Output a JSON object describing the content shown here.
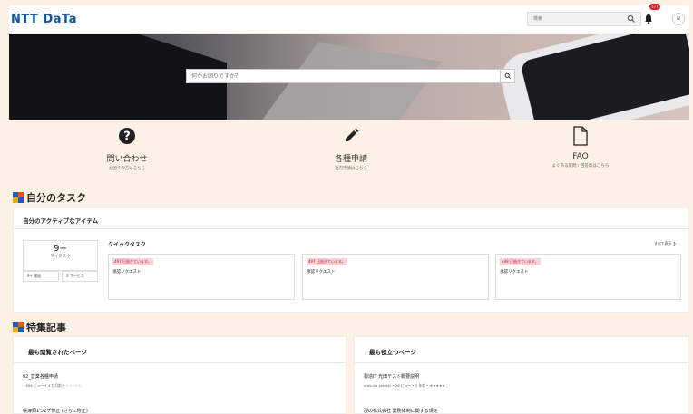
{
  "header": {
    "logo": "NTT DaTa",
    "search_placeholder": "検索",
    "notification_count": "177",
    "avatar_initial": "N"
  },
  "hero": {
    "search_placeholder": "何かお困りですか？"
  },
  "actions": [
    {
      "label": "問い合わせ",
      "sub": "お困りの方はこちら",
      "icon": "question-circle-icon"
    },
    {
      "label": "各種申請",
      "sub": "社内申請はこちら",
      "icon": "pencil-icon"
    },
    {
      "label": "FAQ",
      "sub": "よくある質問 / 回答集はこちら",
      "icon": "document-icon"
    }
  ],
  "tasks": {
    "section_title": "自分のタスク",
    "card_title": "自分のアクティブなアイテム",
    "my_task_count": "9+",
    "my_task_label": "マイタスク",
    "button_overdue": "9+ 遅延",
    "button_service": "0 サービス",
    "quick_title": "クイックタスク",
    "see_all": "すべて表示 ❯",
    "tiles": [
      {
        "tag": "497 日過ぎています。",
        "name": "承認リクエスト"
      },
      {
        "tag": "497 日過ぎています。",
        "name": "承認リクエスト"
      },
      {
        "tag": "498 日過ぎています。",
        "name": "承認リクエスト"
      }
    ]
  },
  "featured": {
    "section_title": "特集記事",
    "most_viewed": {
      "title": "最も閲覧されたページ",
      "articles": [
        {
          "title": "02_営業各種申請",
          "meta": "• 656 ビュー • 4 か月前 • ☆☆☆☆☆"
        },
        {
          "title": "帳簿類1つ2ゲ修正 (さらに修正)",
          "meta": ""
        }
      ]
    },
    "most_useful": {
      "title": "最も役立つページ",
      "articles": [
        {
          "title": "製造IT 光田テスト概要説明",
          "meta": "mitsuda satoshi • 26 ビュー • 2 年前 • ★★★★★"
        },
        {
          "title": "凄の株式会社 業務体制に関する規定",
          "meta": ""
        }
      ]
    }
  },
  "colors": {
    "brand": "#0b56a8",
    "background": "#fdf1e6",
    "overdue_tag_bg": "#fbd2d4",
    "overdue_tag_text": "#b3262c"
  }
}
